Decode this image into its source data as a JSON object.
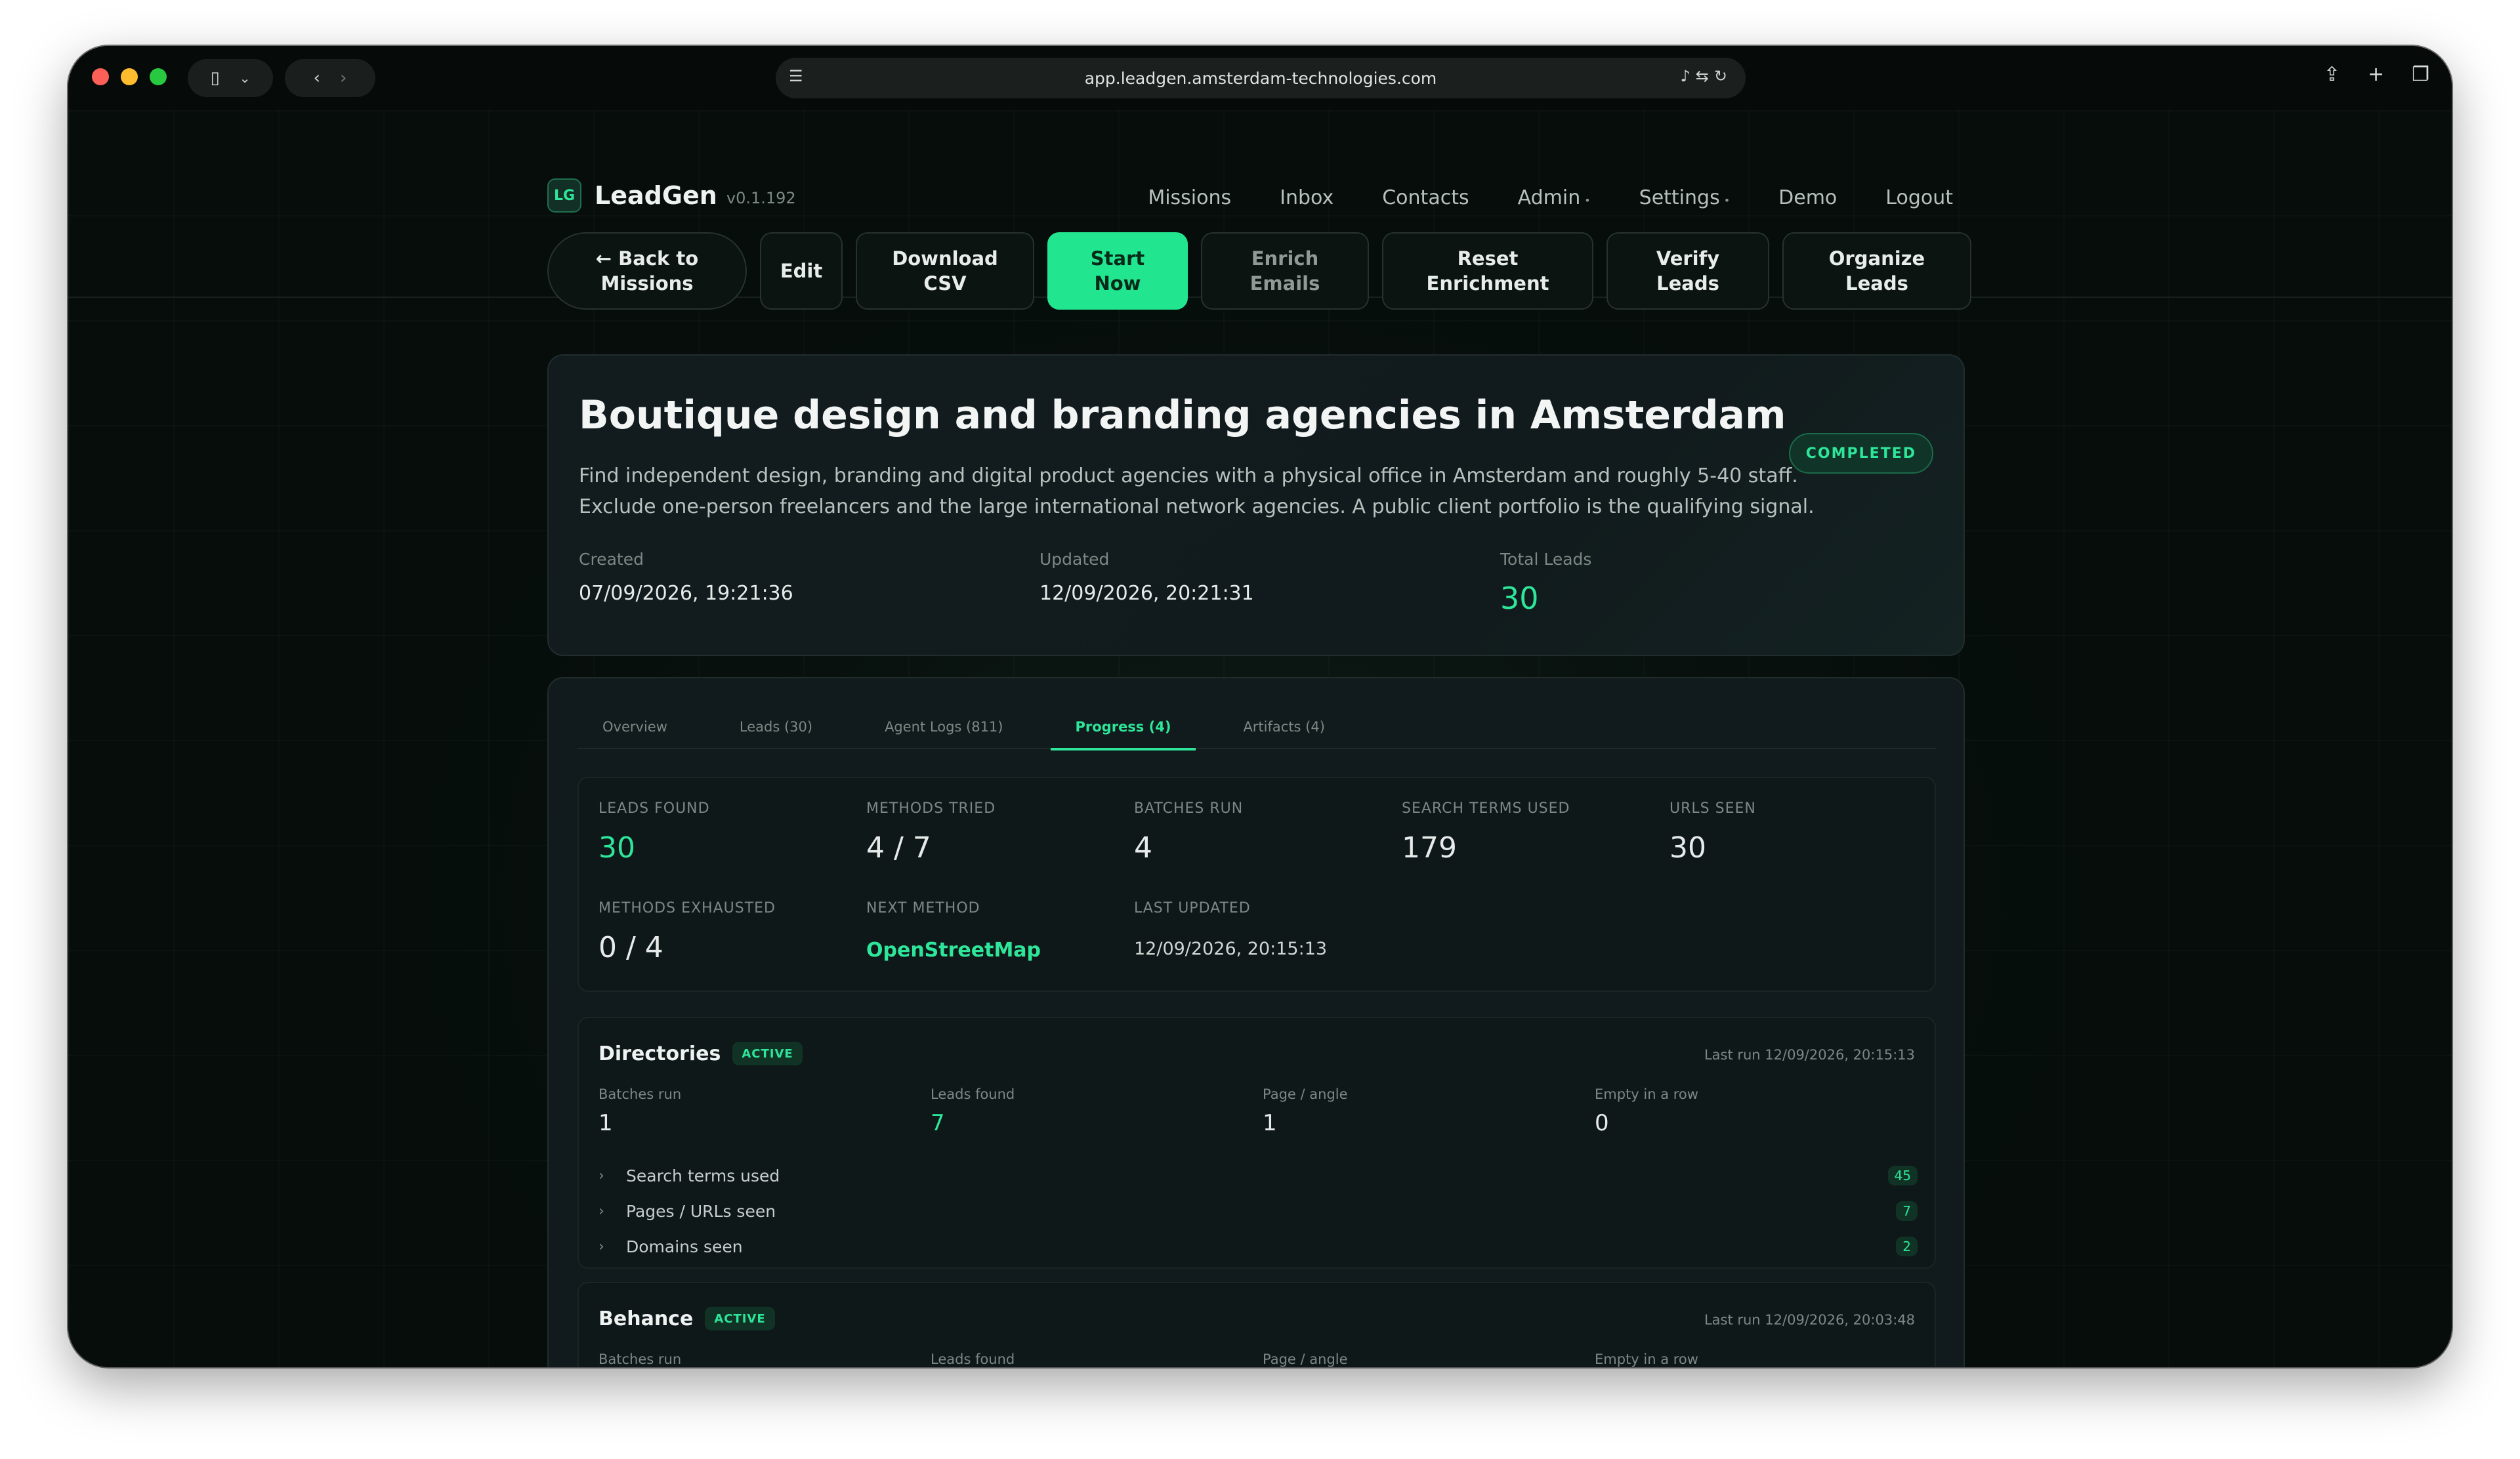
{
  "browser": {
    "url": "app.leadgen.amsterdam-technologies.com"
  },
  "app": {
    "logo_badge": "LG",
    "name": "LeadGen",
    "version": "v0.1.192"
  },
  "nav": {
    "items": [
      {
        "label": "Missions",
        "dropdown": false
      },
      {
        "label": "Inbox",
        "dropdown": false
      },
      {
        "label": "Contacts",
        "dropdown": false
      },
      {
        "label": "Admin",
        "dropdown": true
      },
      {
        "label": "Settings",
        "dropdown": true
      },
      {
        "label": "Demo",
        "dropdown": false
      },
      {
        "label": "Logout",
        "dropdown": false
      }
    ]
  },
  "actions": {
    "back": "← Back to\nMissions",
    "edit": "Edit",
    "download": "Download\nCSV",
    "start": "Start\nNow",
    "enrich": "Enrich\nEmails",
    "reset": "Reset\nEnrichment",
    "verify": "Verify\nLeads",
    "organize": "Organize\nLeads"
  },
  "mission": {
    "title": "Boutique design and branding agencies in Amsterdam",
    "description": "Find independent design, branding and digital product agencies with a physical office in Amsterdam and roughly 5-40 staff. Exclude one-person freelancers and the large international network agencies. A public client portfolio is the qualifying signal.",
    "status": "COMPLETED",
    "created_label": "Created",
    "created": "07/09/2026, 19:21:36",
    "updated_label": "Updated",
    "updated": "12/09/2026, 20:21:31",
    "total_label": "Total Leads",
    "total": "30"
  },
  "tabs": [
    {
      "label": "Overview",
      "active": false
    },
    {
      "label": "Leads (30)",
      "active": false
    },
    {
      "label": "Agent Logs (811)",
      "active": false
    },
    {
      "label": "Progress (4)",
      "active": true
    },
    {
      "label": "Artifacts (4)",
      "active": false
    }
  ],
  "progress": {
    "leads_found_label": "LEADS FOUND",
    "leads_found": "30",
    "methods_tried_label": "METHODS TRIED",
    "methods_tried": "4 / 7",
    "batches_run_label": "BATCHES RUN",
    "batches_run": "4",
    "search_terms_label": "SEARCH TERMS USED",
    "search_terms": "179",
    "urls_seen_label": "URLS SEEN",
    "urls_seen": "30",
    "methods_exhausted_label": "METHODS EXHAUSTED",
    "methods_exhausted": "0 / 4",
    "next_method_label": "NEXT METHOD",
    "next_method": "OpenStreetMap",
    "last_updated_label": "LAST UPDATED",
    "last_updated": "12/09/2026, 20:15:13"
  },
  "methods": [
    {
      "name": "Directories",
      "status": "ACTIVE",
      "last_run": "Last run 12/09/2026, 20:15:13",
      "batches_label": "Batches run",
      "batches": "1",
      "leads_label": "Leads found",
      "leads": "7",
      "page_label": "Page / angle",
      "page": "1",
      "empty_label": "Empty in a row",
      "empty": "0",
      "rows": [
        {
          "label": "Search terms used",
          "count": "45"
        },
        {
          "label": "Pages / URLs seen",
          "count": "7"
        },
        {
          "label": "Domains seen",
          "count": "2"
        }
      ]
    },
    {
      "name": "Behance",
      "status": "ACTIVE",
      "last_run": "Last run 12/09/2026, 20:03:48",
      "batches_label": "Batches run",
      "leads_label": "Leads found",
      "page_label": "Page / angle",
      "empty_label": "Empty in a row"
    }
  ],
  "colors": {
    "accent": "#2ee69a",
    "primary_button": "#22e58f",
    "background": "#07100d"
  }
}
